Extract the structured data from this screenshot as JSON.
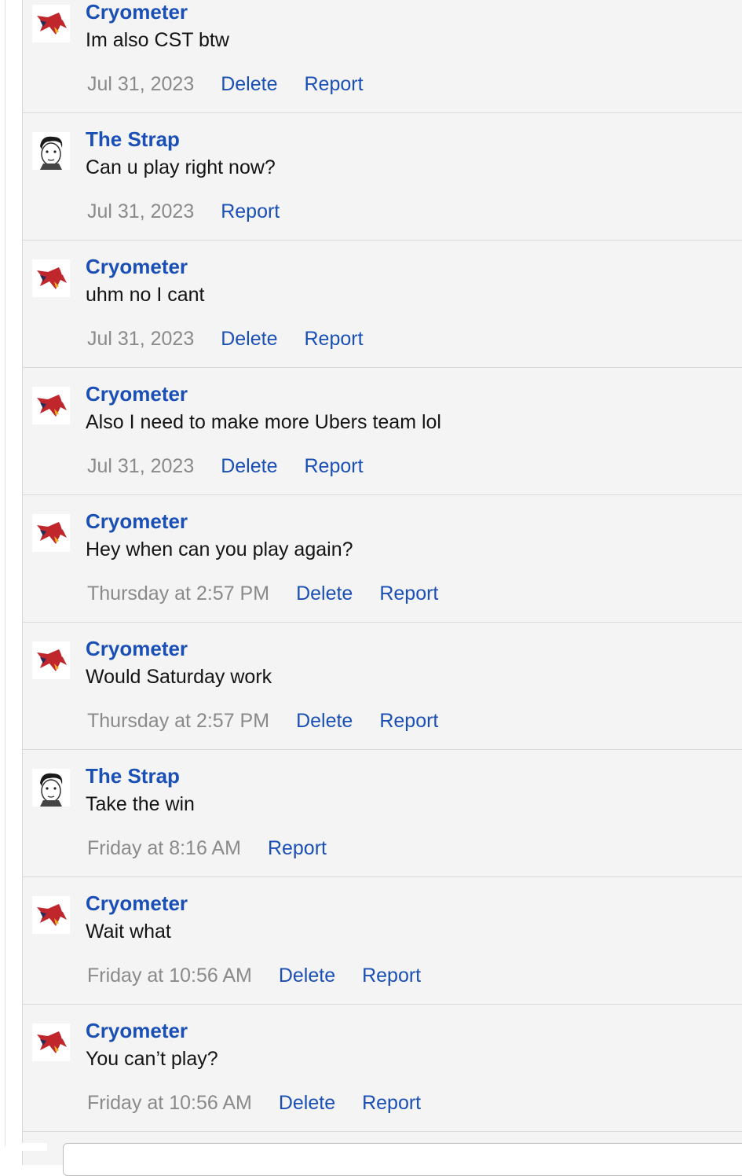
{
  "messages": [
    {
      "user": "Cryometer",
      "avatar": "red-bird-avatar",
      "text": "Im also CST btw",
      "time": "Jul 31, 2023",
      "delete": "Delete",
      "report": "Report"
    },
    {
      "user": "The Strap",
      "avatar": "sketch-face-avatar",
      "text": "Can u play right now?",
      "time": "Jul 31, 2023",
      "delete": null,
      "report": "Report"
    },
    {
      "user": "Cryometer",
      "avatar": "red-bird-avatar",
      "text": "uhm no I cant",
      "time": "Jul 31, 2023",
      "delete": "Delete",
      "report": "Report"
    },
    {
      "user": "Cryometer",
      "avatar": "red-bird-avatar",
      "text": "Also I need to make more Ubers team lol",
      "time": "Jul 31, 2023",
      "delete": "Delete",
      "report": "Report"
    },
    {
      "user": "Cryometer",
      "avatar": "red-bird-avatar",
      "text": "Hey when can you play again?",
      "time": "Thursday at 2:57 PM",
      "delete": "Delete",
      "report": "Report"
    },
    {
      "user": "Cryometer",
      "avatar": "red-bird-avatar",
      "text": "Would Saturday work",
      "time": "Thursday at 2:57 PM",
      "delete": "Delete",
      "report": "Report"
    },
    {
      "user": "The Strap",
      "avatar": "sketch-face-avatar",
      "text": "Take the win",
      "time": "Friday at 8:16 AM",
      "delete": null,
      "report": "Report"
    },
    {
      "user": "Cryometer",
      "avatar": "red-bird-avatar",
      "text": "Wait what",
      "time": "Friday at 10:56 AM",
      "delete": "Delete",
      "report": "Report"
    },
    {
      "user": "Cryometer",
      "avatar": "red-bird-avatar",
      "text": "You can’t play?",
      "time": "Friday at 10:56 AM",
      "delete": "Delete",
      "report": "Report"
    }
  ],
  "colors": {
    "link": "#1a4fb5",
    "timestamp": "#8a8a8a",
    "background": "#f4f4f4",
    "divider": "#d9d9d9"
  }
}
